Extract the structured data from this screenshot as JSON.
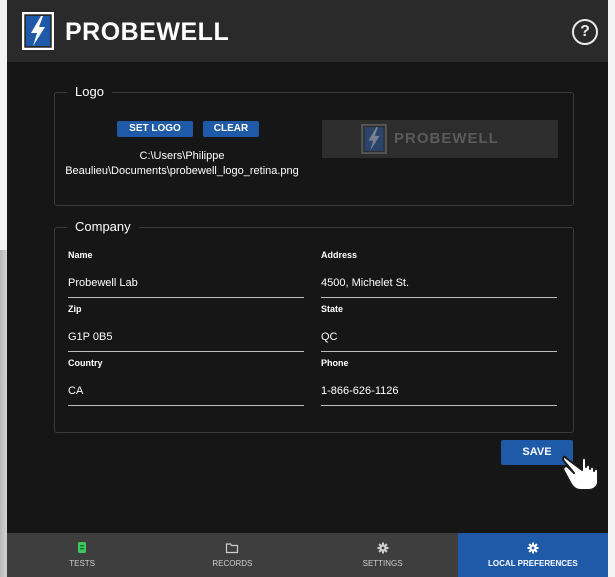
{
  "header": {
    "brand": "PROBEWELL",
    "help_label": "?"
  },
  "logo_section": {
    "legend": "Logo",
    "set_logo_label": "SET LOGO",
    "clear_label": "CLEAR",
    "path_line1": "C:\\Users\\Philippe",
    "path_line2": "Beaulieu\\Documents\\probewell_logo_retina.png",
    "preview_brand": "PROBEWELL"
  },
  "company_section": {
    "legend": "Company",
    "fields": [
      {
        "label": "Name",
        "value": "Probewell Lab"
      },
      {
        "label": "Address",
        "value": "4500, Michelet St."
      },
      {
        "label": "Zip",
        "value": "G1P 0B5"
      },
      {
        "label": "State",
        "value": "QC"
      },
      {
        "label": "Country",
        "value": "CA"
      },
      {
        "label": "Phone",
        "value": "1-866-626-1126"
      }
    ]
  },
  "save_label": "SAVE",
  "nav": {
    "items": [
      {
        "label": "TESTS",
        "icon": "tests-icon",
        "active": false
      },
      {
        "label": "RECORDS",
        "icon": "folder-icon",
        "active": false
      },
      {
        "label": "SETTINGS",
        "icon": "gear-icon",
        "active": false
      },
      {
        "label": "LOCAL PREFERENCES",
        "icon": "gear-icon",
        "active": true
      }
    ]
  },
  "colors": {
    "accent": "#1f5aa8",
    "background": "#161616",
    "header": "#2a2a2a",
    "tests_icon": "#3cc85a"
  }
}
